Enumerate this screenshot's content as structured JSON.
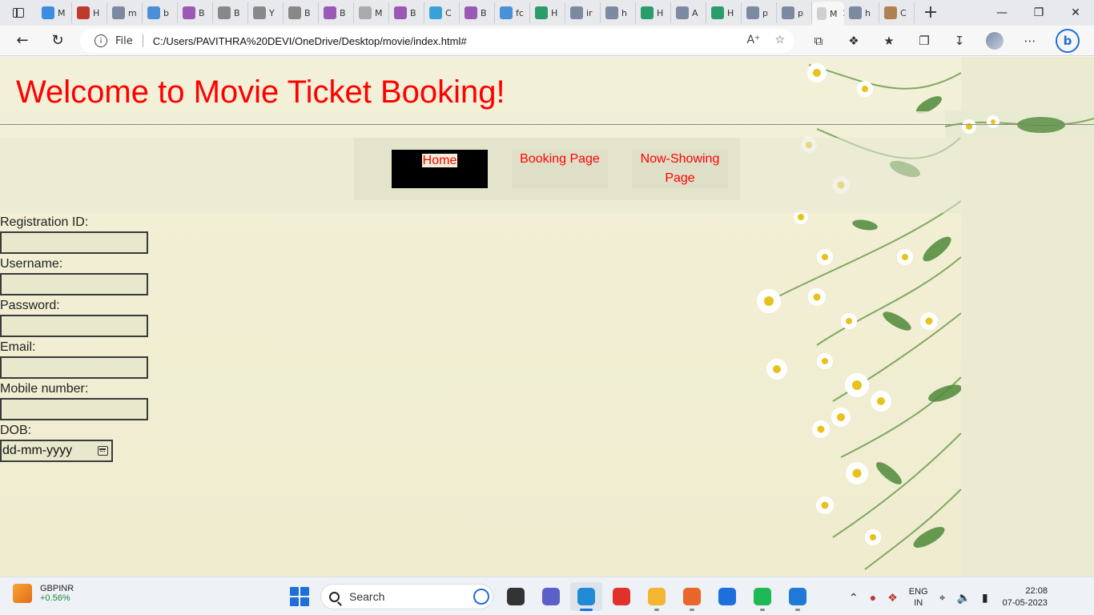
{
  "browser": {
    "tabs": [
      {
        "letter": "M",
        "color": "#3c8dde"
      },
      {
        "letter": "H",
        "color": "#c0392b"
      },
      {
        "letter": "m",
        "color": "#7b8aa0"
      },
      {
        "letter": "b",
        "color": "#4a90d9"
      },
      {
        "letter": "B",
        "color": "#9b59b6"
      },
      {
        "letter": "B",
        "color": "#888888"
      },
      {
        "letter": "Y",
        "color": "#888888"
      },
      {
        "letter": "B",
        "color": "#888888"
      },
      {
        "letter": "B",
        "color": "#9b59b6"
      },
      {
        "letter": "M",
        "color": "#aaaaaa"
      },
      {
        "letter": "B",
        "color": "#9b59b6"
      },
      {
        "letter": "C",
        "color": "#3aa0d8"
      },
      {
        "letter": "B",
        "color": "#9b59b6"
      },
      {
        "letter": "fc",
        "color": "#4a90d9"
      },
      {
        "letter": "H",
        "color": "#2a9d6a"
      },
      {
        "letter": "ir",
        "color": "#7b8aa0"
      },
      {
        "letter": "h",
        "color": "#7b8aa0"
      },
      {
        "letter": "H",
        "color": "#2a9d6a"
      },
      {
        "letter": "A",
        "color": "#7b8aa0"
      },
      {
        "letter": "H",
        "color": "#2a9d6a"
      },
      {
        "letter": "p",
        "color": "#7b8aa0"
      },
      {
        "letter": "p",
        "color": "#7b8aa0"
      }
    ],
    "active_tab_label": "M",
    "trailing_tabs": [
      {
        "letter": "h",
        "color": "#7b8aa0"
      },
      {
        "letter": "C",
        "color": "#b08050"
      }
    ],
    "file_label": "File",
    "url": "C:/Users/PAVITHRA%20DEVI/OneDrive/Desktop/movie/index.html#"
  },
  "site": {
    "title": "Welcome to Movie Ticket Booking!",
    "menu": {
      "home": "Home",
      "booking": "Booking Page",
      "now_showing_line1": "Now-Showing",
      "now_showing_line2": "Page"
    },
    "accent_color": "#ff0000"
  },
  "form": {
    "registration_id_label": "Registration ID:",
    "username_label": "Username:",
    "password_label": "Password:",
    "email_label": "Email:",
    "mobile_label": "Mobile number:",
    "dob_label": "DOB:",
    "dob_placeholder": "dd-mm-yyyy"
  },
  "taskbar": {
    "ticker": "GBPINR",
    "ticker_change": "+0.56%",
    "search_placeholder": "Search",
    "lang_line1": "ENG",
    "lang_line2": "IN",
    "time": "22:08",
    "date": "07-05-2023",
    "apps": [
      {
        "name": "file-explorer-window-icon",
        "color": "#333333",
        "state": ""
      },
      {
        "name": "video-call-icon",
        "color": "#5b5fc7",
        "state": ""
      },
      {
        "name": "edge-browser-icon",
        "color": "#1f8bd6",
        "state": "active"
      },
      {
        "name": "wps-office-icon",
        "color": "#e0322b",
        "state": ""
      },
      {
        "name": "folder-icon",
        "color": "#f2b632",
        "state": "run"
      },
      {
        "name": "firefox-icon",
        "color": "#e8662a",
        "state": "run"
      },
      {
        "name": "mail-icon",
        "color": "#1e6fd9",
        "state": ""
      },
      {
        "name": "spotify-icon",
        "color": "#1db954",
        "state": "run"
      },
      {
        "name": "vscode-icon",
        "color": "#1f7ad6",
        "state": "run"
      }
    ]
  }
}
